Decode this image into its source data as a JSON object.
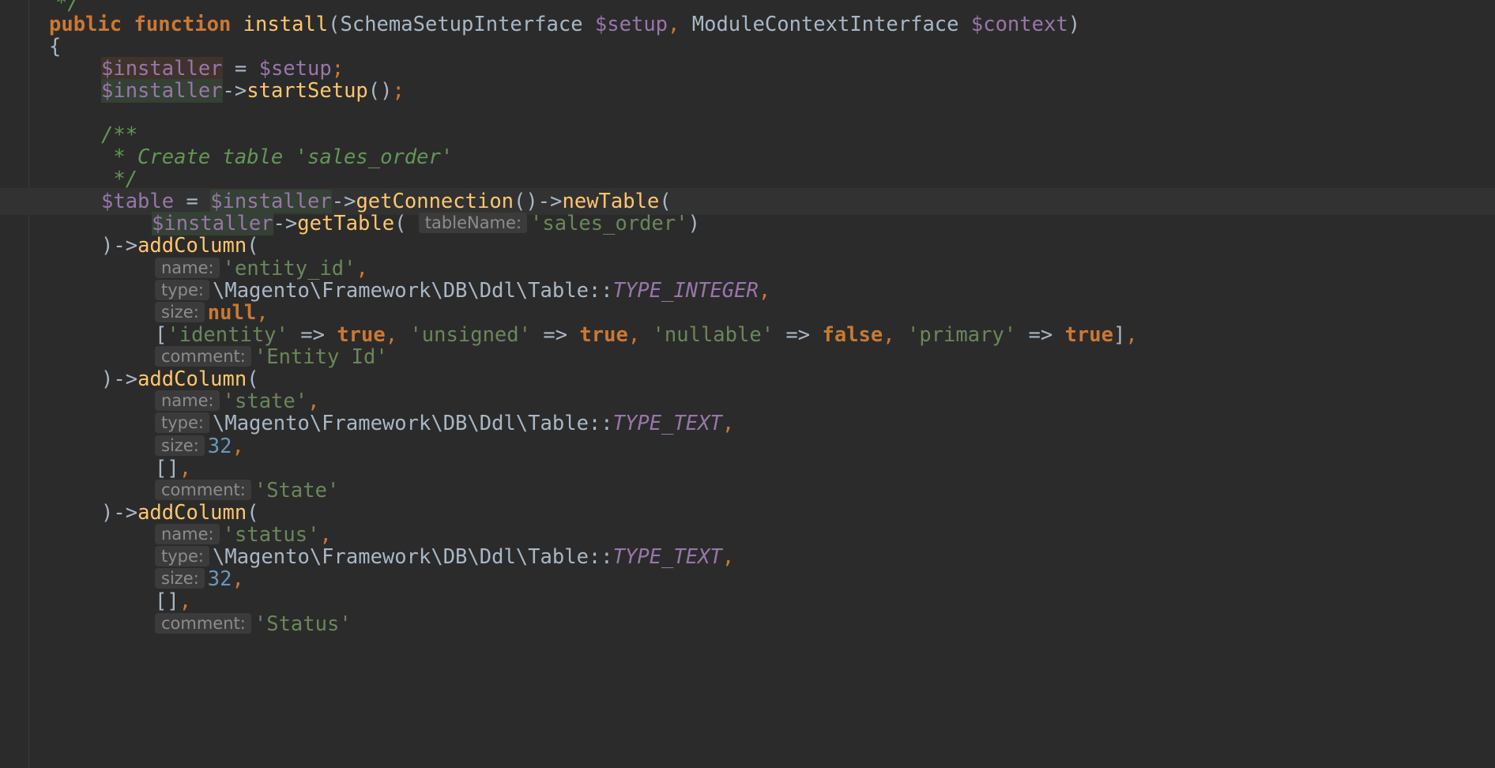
{
  "colors": {
    "background": "#2b2b2b",
    "current_line": "#323232",
    "keyword": "#cc7832",
    "function": "#ffc66d",
    "variable": "#9876aa",
    "string": "#6a8759",
    "number": "#6897bb",
    "doc_comment": "#629755",
    "default_text": "#a9b7c6",
    "hint_bg": "#3b3b3b",
    "hint_text": "#8c8c8c"
  },
  "editor": {
    "current_line_index": 8,
    "lines": [
      [
        {
          "t": "*/",
          "c": "doc"
        }
      ],
      [
        {
          "t": "public",
          "c": "kw"
        },
        {
          "t": " ",
          "c": "op"
        },
        {
          "t": "function",
          "c": "kw"
        },
        {
          "t": " ",
          "c": "op"
        },
        {
          "t": "install",
          "c": "fn"
        },
        {
          "t": "(",
          "c": "op"
        },
        {
          "t": "SchemaSetupInterface",
          "c": "cls"
        },
        {
          "t": " ",
          "c": "op"
        },
        {
          "t": "$setup",
          "c": "var"
        },
        {
          "t": ",",
          "c": "punct"
        },
        {
          "t": " ",
          "c": "op"
        },
        {
          "t": "ModuleContextInterface",
          "c": "cls"
        },
        {
          "t": " ",
          "c": "op"
        },
        {
          "t": "$context",
          "c": "var"
        },
        {
          "t": ")",
          "c": "op"
        }
      ],
      [
        {
          "t": "{",
          "c": "op"
        }
      ],
      [
        {
          "t": "$installer",
          "c": "var var-hl2"
        },
        {
          "t": " = ",
          "c": "op"
        },
        {
          "t": "$setup",
          "c": "var"
        },
        {
          "t": ";",
          "c": "punct"
        }
      ],
      [
        {
          "t": "$installer",
          "c": "var var-hl"
        },
        {
          "t": "->",
          "c": "op"
        },
        {
          "t": "startSetup",
          "c": "fn"
        },
        {
          "t": "()",
          "c": "op"
        },
        {
          "t": ";",
          "c": "punct"
        }
      ],
      [],
      [
        {
          "t": "/**",
          "c": "doc"
        }
      ],
      [
        {
          "t": " * Create table 'sales_order'",
          "c": "doc"
        }
      ],
      [
        {
          "t": " */",
          "c": "doc"
        }
      ],
      [
        {
          "t": "$table",
          "c": "var"
        },
        {
          "t": " = ",
          "c": "op"
        },
        {
          "t": "$insta",
          "c": "var var-hl"
        },
        {
          "caret": true
        },
        {
          "t": "ller",
          "c": "var var-hl"
        },
        {
          "t": "->",
          "c": "op"
        },
        {
          "t": "getConnection",
          "c": "fn"
        },
        {
          "t": "()",
          "c": "op"
        },
        {
          "t": "->",
          "c": "op"
        },
        {
          "t": "newTable",
          "c": "fn"
        },
        {
          "t": "(",
          "c": "op"
        }
      ],
      [
        {
          "t": "$installer",
          "c": "var var-hl"
        },
        {
          "t": "->",
          "c": "op"
        },
        {
          "t": "getTable",
          "c": "fn"
        },
        {
          "t": "( ",
          "c": "op"
        },
        {
          "hint": "tableName:"
        },
        {
          "t": "'sales_order'",
          "c": "str"
        },
        {
          "t": ")",
          "c": "op"
        }
      ],
      [
        {
          "t": ")->",
          "c": "op"
        },
        {
          "t": "addColumn",
          "c": "fn"
        },
        {
          "t": "(",
          "c": "op"
        }
      ],
      [
        {
          "hint": "name:"
        },
        {
          "t": "'entity_id'",
          "c": "str"
        },
        {
          "t": ",",
          "c": "punct"
        }
      ],
      [
        {
          "hint": "type:"
        },
        {
          "t": "\\Magento\\Framework\\DB\\Ddl\\Table::",
          "c": "cls"
        },
        {
          "t": "TYPE_INTEGER",
          "c": "const"
        },
        {
          "t": ",",
          "c": "punct"
        }
      ],
      [
        {
          "hint": "size:"
        },
        {
          "t": "null",
          "c": "kw"
        },
        {
          "t": ",",
          "c": "punct"
        }
      ],
      [
        {
          "t": "[",
          "c": "op"
        },
        {
          "t": "'identity'",
          "c": "str"
        },
        {
          "t": " => ",
          "c": "op"
        },
        {
          "t": "true",
          "c": "kw"
        },
        {
          "t": ",",
          "c": "punct"
        },
        {
          "t": " ",
          "c": "op"
        },
        {
          "t": "'unsigned'",
          "c": "str"
        },
        {
          "t": " => ",
          "c": "op"
        },
        {
          "t": "true",
          "c": "kw"
        },
        {
          "t": ",",
          "c": "punct"
        },
        {
          "t": " ",
          "c": "op"
        },
        {
          "t": "'nullable'",
          "c": "str"
        },
        {
          "t": " => ",
          "c": "op"
        },
        {
          "t": "false",
          "c": "kw"
        },
        {
          "t": ",",
          "c": "punct"
        },
        {
          "t": " ",
          "c": "op"
        },
        {
          "t": "'primary'",
          "c": "str"
        },
        {
          "t": " => ",
          "c": "op"
        },
        {
          "t": "true",
          "c": "kw"
        },
        {
          "t": "]",
          "c": "op"
        },
        {
          "t": ",",
          "c": "punct"
        }
      ],
      [
        {
          "hint": "comment:"
        },
        {
          "t": "'Entity Id'",
          "c": "str"
        }
      ],
      [
        {
          "t": ")->",
          "c": "op"
        },
        {
          "t": "addColumn",
          "c": "fn"
        },
        {
          "t": "(",
          "c": "op"
        }
      ],
      [
        {
          "hint": "name:"
        },
        {
          "t": "'state'",
          "c": "str"
        },
        {
          "t": ",",
          "c": "punct"
        }
      ],
      [
        {
          "hint": "type:"
        },
        {
          "t": "\\Magento\\Framework\\DB\\Ddl\\Table::",
          "c": "cls"
        },
        {
          "t": "TYPE_TEXT",
          "c": "const"
        },
        {
          "t": ",",
          "c": "punct"
        }
      ],
      [
        {
          "hint": "size:"
        },
        {
          "t": "32",
          "c": "num"
        },
        {
          "t": ",",
          "c": "punct"
        }
      ],
      [
        {
          "t": "[]",
          "c": "op"
        },
        {
          "t": ",",
          "c": "punct"
        }
      ],
      [
        {
          "hint": "comment:"
        },
        {
          "t": "'State'",
          "c": "str"
        }
      ],
      [
        {
          "t": ")->",
          "c": "op"
        },
        {
          "t": "addColumn",
          "c": "fn"
        },
        {
          "t": "(",
          "c": "op"
        }
      ],
      [
        {
          "hint": "name:"
        },
        {
          "t": "'status'",
          "c": "str"
        },
        {
          "t": ",",
          "c": "punct"
        }
      ],
      [
        {
          "hint": "type:"
        },
        {
          "t": "\\Magento\\Framework\\DB\\Ddl\\Table::",
          "c": "cls"
        },
        {
          "t": "TYPE_TEXT",
          "c": "const"
        },
        {
          "t": ",",
          "c": "punct"
        }
      ],
      [
        {
          "hint": "size:"
        },
        {
          "t": "32",
          "c": "num"
        },
        {
          "t": ",",
          "c": "punct"
        }
      ],
      [
        {
          "t": "[]",
          "c": "op"
        },
        {
          "t": ",",
          "c": "punct"
        }
      ],
      [
        {
          "hint": "comment:"
        },
        {
          "t": "'Status'",
          "c": "str"
        }
      ]
    ]
  }
}
